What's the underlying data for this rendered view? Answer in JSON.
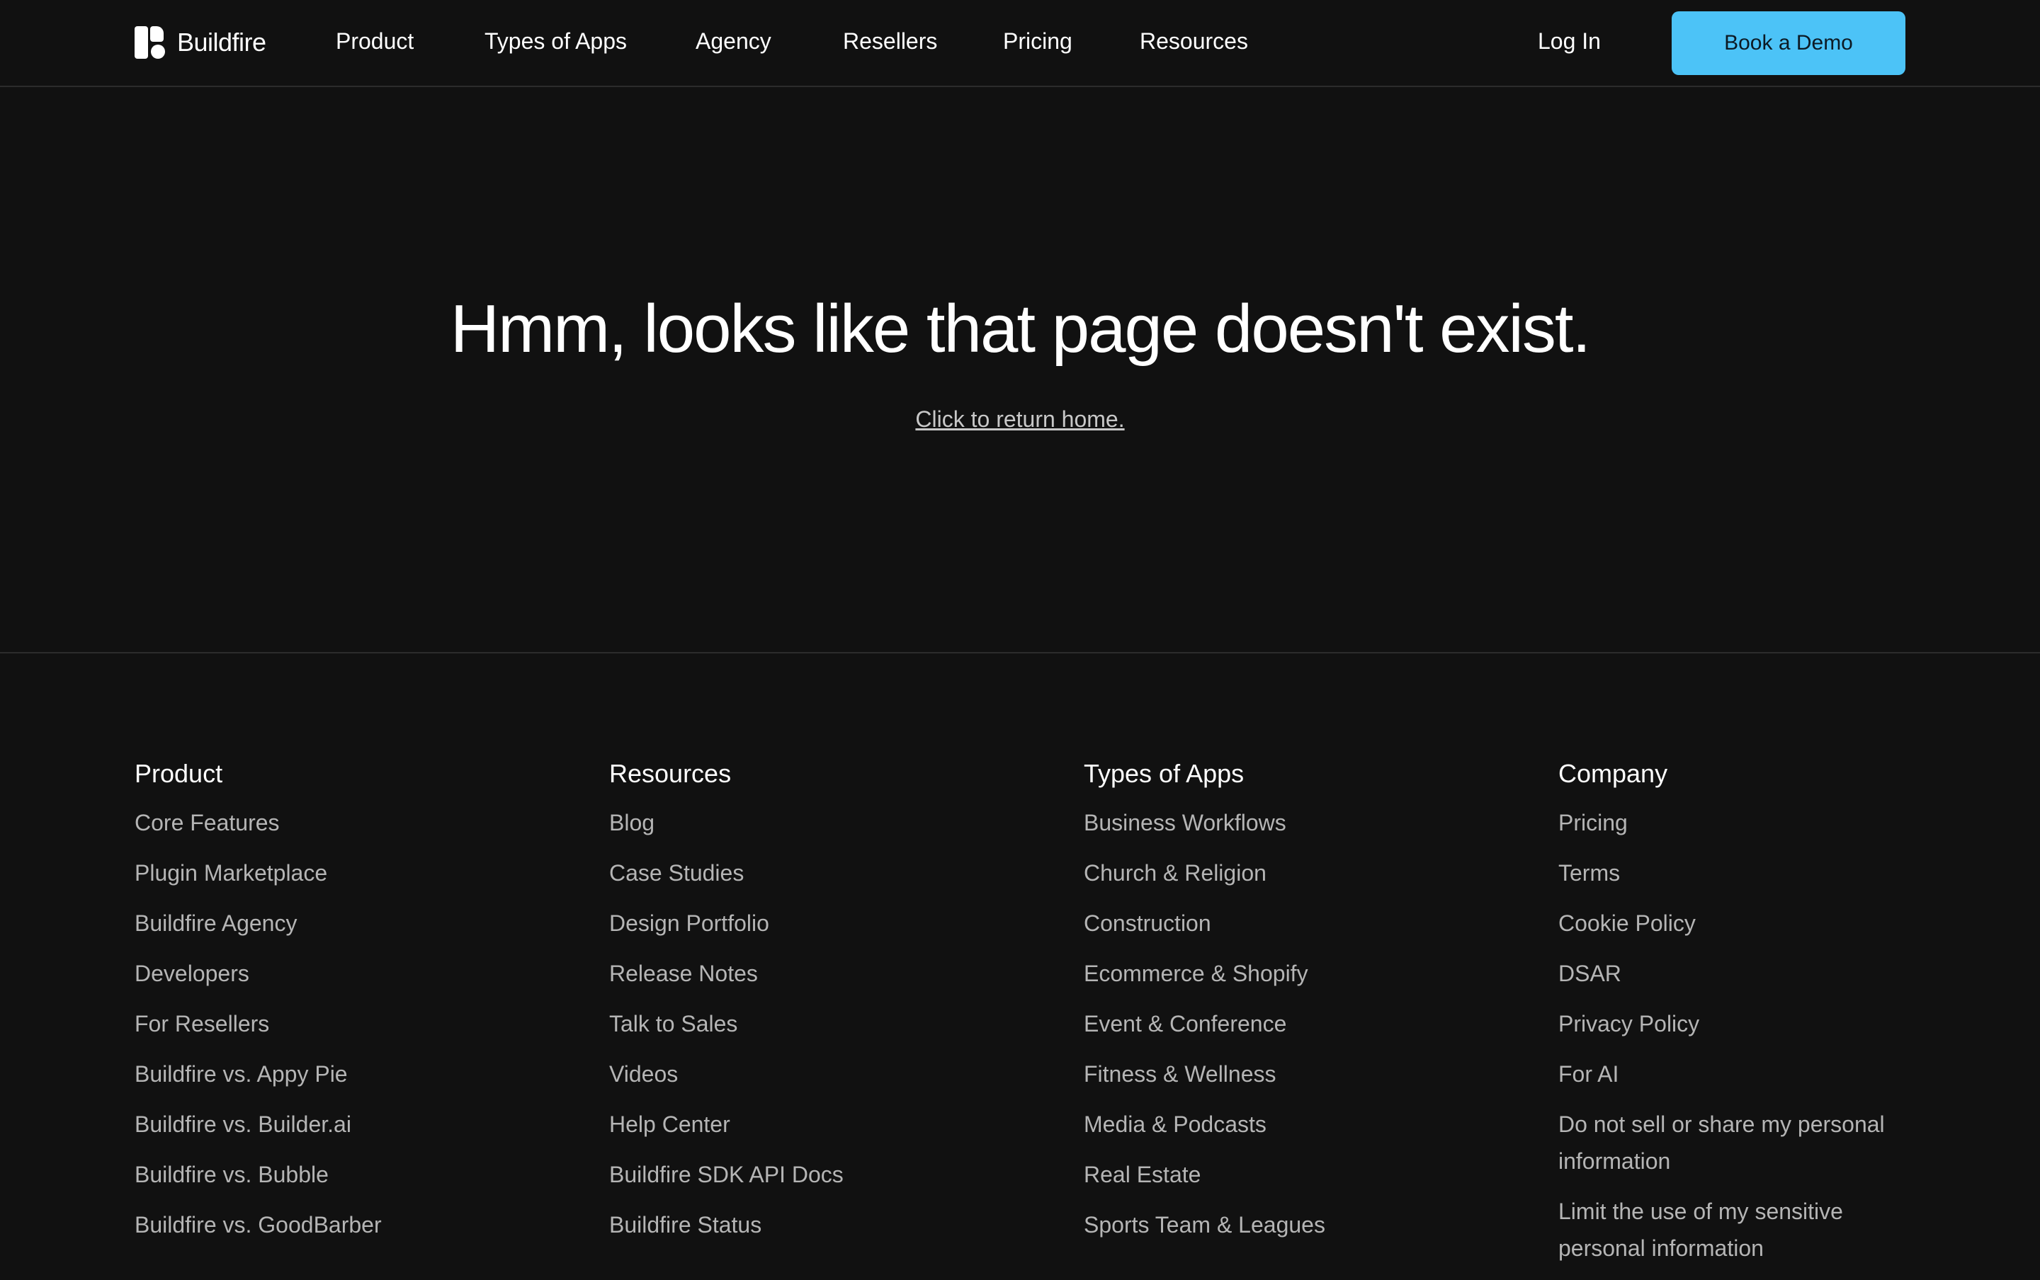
{
  "nav": {
    "brand": "Buildfire",
    "links": [
      "Product",
      "Types of Apps",
      "Agency",
      "Resellers",
      "Pricing",
      "Resources"
    ],
    "login": "Log In",
    "cta": "Book a Demo"
  },
  "hero": {
    "title": "Hmm, looks like that page doesn't exist.",
    "link": "Click to return home."
  },
  "footer": {
    "columns": [
      {
        "title": "Product",
        "items": [
          "Core Features",
          "Plugin Marketplace",
          "Buildfire Agency",
          "Developers",
          "For Resellers",
          "Buildfire vs. Appy Pie",
          "Buildfire vs. Builder.ai",
          "Buildfire vs. Bubble",
          "Buildfire vs. GoodBarber"
        ]
      },
      {
        "title": "Resources",
        "items": [
          "Blog",
          "Case Studies",
          "Design Portfolio",
          "Release Notes",
          "Talk to Sales",
          "Videos",
          "Help Center",
          "Buildfire SDK API Docs",
          "Buildfire Status"
        ]
      },
      {
        "title": "Types of Apps",
        "items": [
          "Business Workflows",
          "Church & Religion",
          "Construction",
          "Ecommerce & Shopify",
          "Event & Conference",
          "Fitness & Wellness",
          "Media & Podcasts",
          "Real Estate",
          "Sports Team & Leagues"
        ]
      },
      {
        "title": "Company",
        "items": [
          "Pricing",
          "Terms",
          "Cookie Policy",
          "DSAR",
          "Privacy Policy",
          "For AI",
          "Do not sell or share my personal information",
          "Limit the use of my sensitive personal information"
        ]
      }
    ]
  },
  "colors": {
    "background": "#111111",
    "accent": "#4cc3f7",
    "muted_text": "#b5b5b5"
  }
}
